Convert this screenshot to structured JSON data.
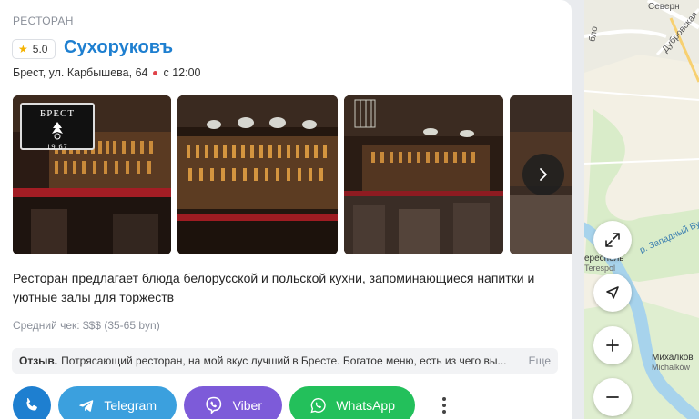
{
  "place": {
    "category": "РЕСТОРАН",
    "rating": "5.0",
    "name": "Сухоруковъ",
    "address": "Брест, ул. Карбышева, 64",
    "hours": "с 12:00",
    "logo_text": "БРЕСТ",
    "logo_year": "19 67",
    "description": "Ресторан предлагает блюда белорусской и польской кухни, запоминающиеся напитки и уютные залы для торжеств",
    "avg_check": "Средний чек: $$$ (35-65 byn)",
    "review_label": "Отзыв.",
    "review_text": "Потрясающий ресторан, на мой вкус лучший в Бресте. Богатое меню, есть из чего вы...",
    "review_more": "Еще"
  },
  "actions": {
    "telegram": "Telegram",
    "viber": "Viber",
    "whatsapp": "WhatsApp"
  },
  "map": {
    "labels": {
      "north": "Северн",
      "dubrovskaya": "Дубровская",
      "blo": "бло",
      "zapadny": "р. Западный Буг",
      "terespol_ru": "ересполь",
      "terespol_pl": "Terespol",
      "mikhalkov_ru": "Михалков",
      "mikhalkov_pl": "Michalków"
    }
  },
  "colors": {
    "accent": "#1e7fd0",
    "telegram": "#3ba0de",
    "viber": "#7d5bd9",
    "whatsapp": "#23c05b",
    "rating_star": "#f5b301"
  }
}
